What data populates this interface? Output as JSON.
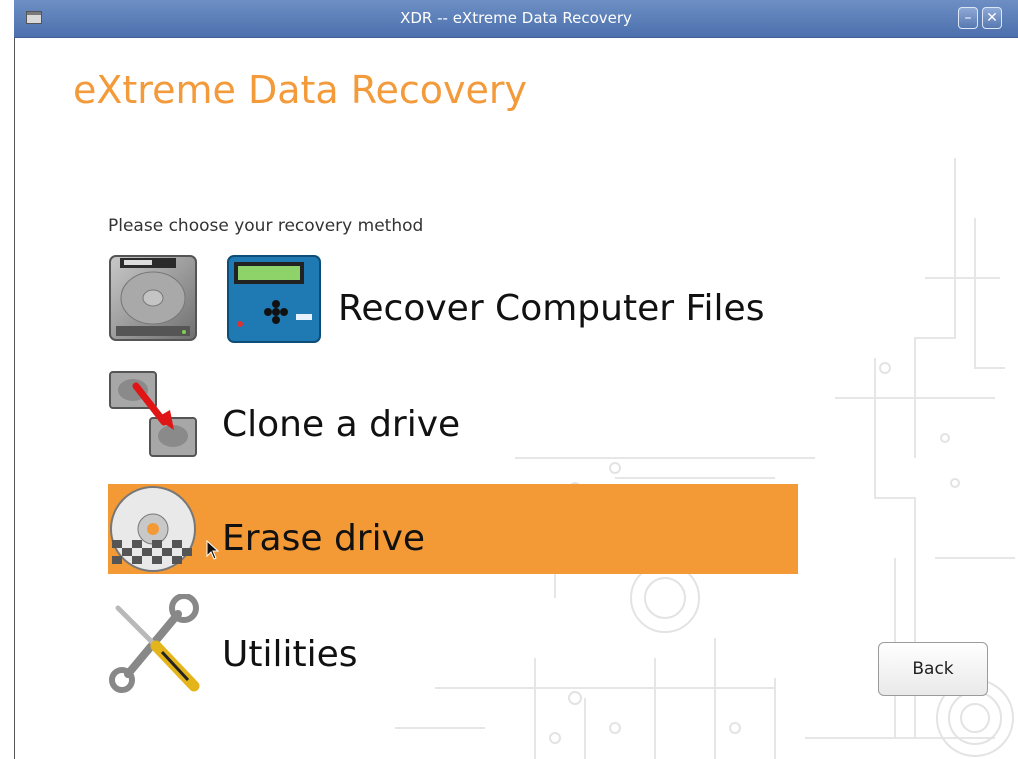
{
  "window": {
    "title": "XDR -- eXtreme Data Recovery",
    "minimize_glyph": "–",
    "close_glyph": "✕"
  },
  "app": {
    "title": "eXtreme Data Recovery",
    "prompt": "Please choose your recovery method"
  },
  "menu": {
    "items": [
      {
        "label": "Recover Computer Files",
        "icons": [
          "hard-drive-icon",
          "recovery-device-icon"
        ],
        "selected": false
      },
      {
        "label": "Clone a drive",
        "icons": [
          "clone-drive-icon"
        ],
        "selected": false
      },
      {
        "label": "Erase drive",
        "icons": [
          "erase-disc-icon"
        ],
        "selected": true
      },
      {
        "label": "Utilities",
        "icons": [
          "tools-icon"
        ],
        "selected": false
      }
    ]
  },
  "buttons": {
    "back": "Back"
  },
  "colors": {
    "accent": "#f39a37",
    "title_bar": "#5a7dba",
    "title_text": "#f39a3b"
  }
}
